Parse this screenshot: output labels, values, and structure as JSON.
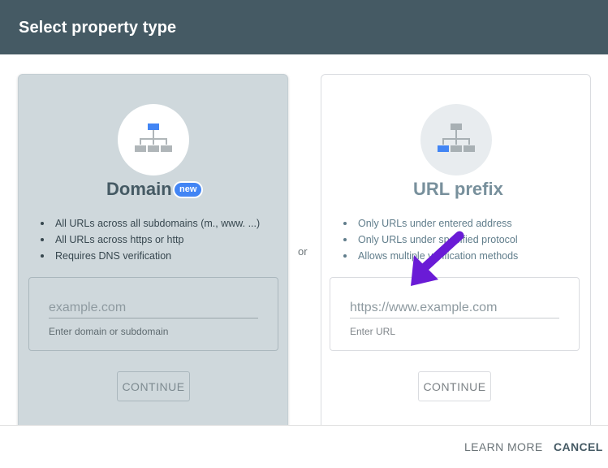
{
  "dialog": {
    "title": "Select property type"
  },
  "separator": "or",
  "domain": {
    "icon": "sitemap-icon",
    "title": "Domain",
    "badge": "new",
    "bullets": [
      "All URLs across all subdomains (m., www. ...)",
      "All URLs across https or http",
      "Requires DNS verification"
    ],
    "input": {
      "value": "",
      "placeholder": "example.com"
    },
    "helper": "Enter domain or subdomain",
    "continue_label": "CONTINUE"
  },
  "url_prefix": {
    "icon": "sitemap-icon",
    "title": "URL prefix",
    "bullets": [
      "Only URLs under entered address",
      "Only URLs under specified protocol",
      "Allows multiple verification methods"
    ],
    "input": {
      "value": "",
      "placeholder": "https://www.example.com"
    },
    "helper": "Enter URL",
    "continue_label": "CONTINUE"
  },
  "annotation": {
    "icon": "purple-arrow-icon",
    "color": "#6a1bd6"
  },
  "footer": {
    "learn_more_label": "LEARN MORE",
    "cancel_label": "CANCEL"
  },
  "colors": {
    "header": "#455a64",
    "domain_card": "#cfd8dc",
    "accent_blue": "#4285f4"
  }
}
